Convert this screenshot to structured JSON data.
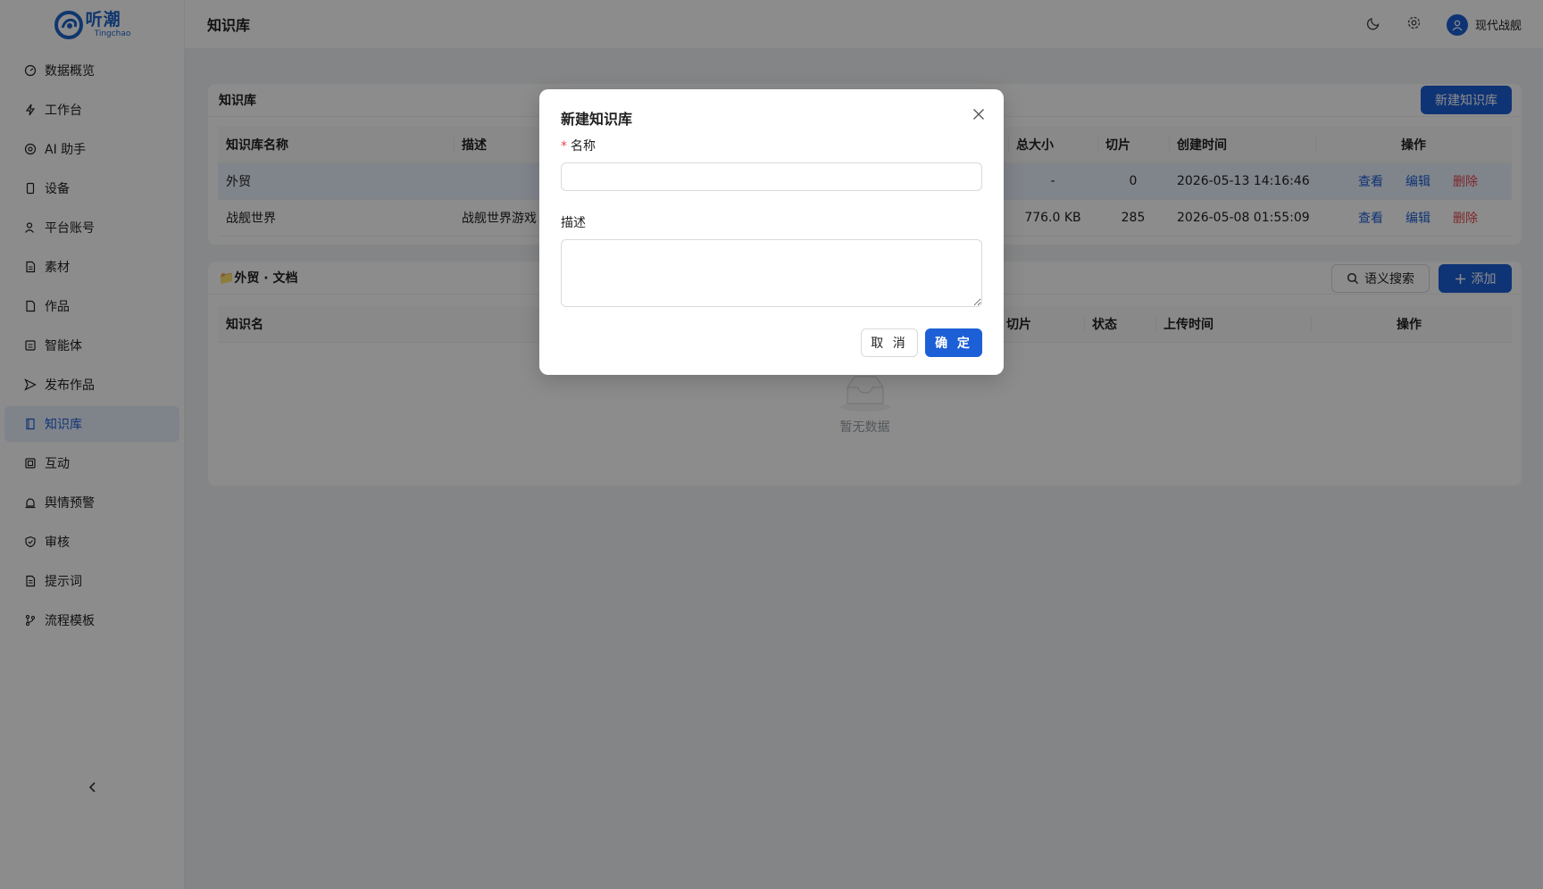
{
  "brand": {
    "name_cn": "听潮",
    "name_en": "Tingchao",
    "color": "#1d5fd6"
  },
  "sidebar": {
    "items": [
      {
        "label": "数据概览",
        "icon": "dashboard-icon"
      },
      {
        "label": "工作台",
        "icon": "lightning-icon"
      },
      {
        "label": "AI 助手",
        "icon": "ai-assistant-icon"
      },
      {
        "label": "设备",
        "icon": "device-icon"
      },
      {
        "label": "平台账号",
        "icon": "account-icon"
      },
      {
        "label": "素材",
        "icon": "material-icon"
      },
      {
        "label": "作品",
        "icon": "works-icon"
      },
      {
        "label": "智能体",
        "icon": "agent-icon"
      },
      {
        "label": "发布作品",
        "icon": "send-icon"
      },
      {
        "label": "知识库",
        "icon": "book-icon"
      },
      {
        "label": "互动",
        "icon": "interaction-icon"
      },
      {
        "label": "舆情预警",
        "icon": "alarm-icon"
      },
      {
        "label": "审核",
        "icon": "shield-check-icon"
      },
      {
        "label": "提示词",
        "icon": "prompt-icon"
      },
      {
        "label": "流程模板",
        "icon": "branch-icon"
      }
    ],
    "active_index": 9
  },
  "header": {
    "title": "知识库",
    "user_name": "现代战舰"
  },
  "kb_card": {
    "title": "知识库",
    "new_button": "新建知识库",
    "columns": [
      "知识库名称",
      "描述",
      "总大小",
      "切片",
      "创建时间",
      "操作"
    ],
    "rows": [
      {
        "name": "外贸",
        "desc": "",
        "size": "-",
        "chunks": "0",
        "created": "2026-05-13 14:16:46"
      },
      {
        "name": "战舰世界",
        "desc": "战舰世界游戏",
        "size": "776.0 KB",
        "chunks": "285",
        "created": "2026-05-08 01:55:09"
      }
    ],
    "actions": {
      "view": "查看",
      "edit": "编辑",
      "delete": "删除"
    }
  },
  "doc_card": {
    "title": "📁外贸 · 文档",
    "search_button": "语义搜索",
    "add_button": "添加",
    "columns": [
      "知识名",
      "切片",
      "状态",
      "上传时间",
      "操作"
    ],
    "empty_text": "暂无数据"
  },
  "modal": {
    "title": "新建知识库",
    "name_label": "名称",
    "name_value": "",
    "desc_label": "描述",
    "desc_value": "",
    "cancel_label": "取 消",
    "ok_label": "确 定"
  }
}
